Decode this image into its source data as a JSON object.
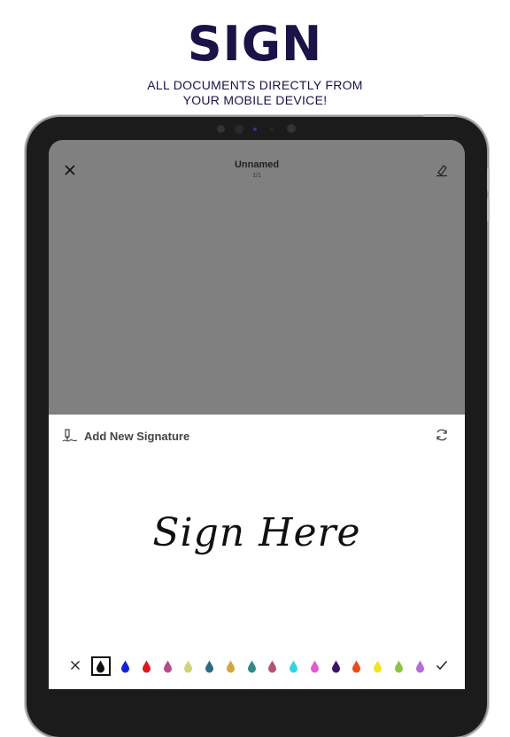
{
  "promo": {
    "headline": "SIGN",
    "subline_1": "ALL DOCUMENTS DIRECTLY FROM",
    "subline_2": "YOUR MOBILE DEVICE!"
  },
  "toolbar": {
    "title": "Unnamed",
    "page_indicator": "1/1",
    "close_icon": "close-icon",
    "edit_icon": "pen-edit-icon"
  },
  "signature_panel": {
    "title": "Add New Signature",
    "title_icon": "signature-pen-icon",
    "refresh_icon": "refresh-icon",
    "placeholder": "Sign Here"
  },
  "palette": {
    "close_icon": "close-icon",
    "confirm_icon": "checkmark-icon",
    "colors": [
      "#111111",
      "#1322d6",
      "#e0161d",
      "#b84a8c",
      "#cfd474",
      "#2f6b80",
      "#d3a53a",
      "#2e8a86",
      "#b8507a",
      "#2fd6e0",
      "#e25ad0",
      "#3a1565",
      "#ec4a16",
      "#f0e61f",
      "#8cc63f",
      "#b86ad8"
    ],
    "selected_index": 0
  }
}
